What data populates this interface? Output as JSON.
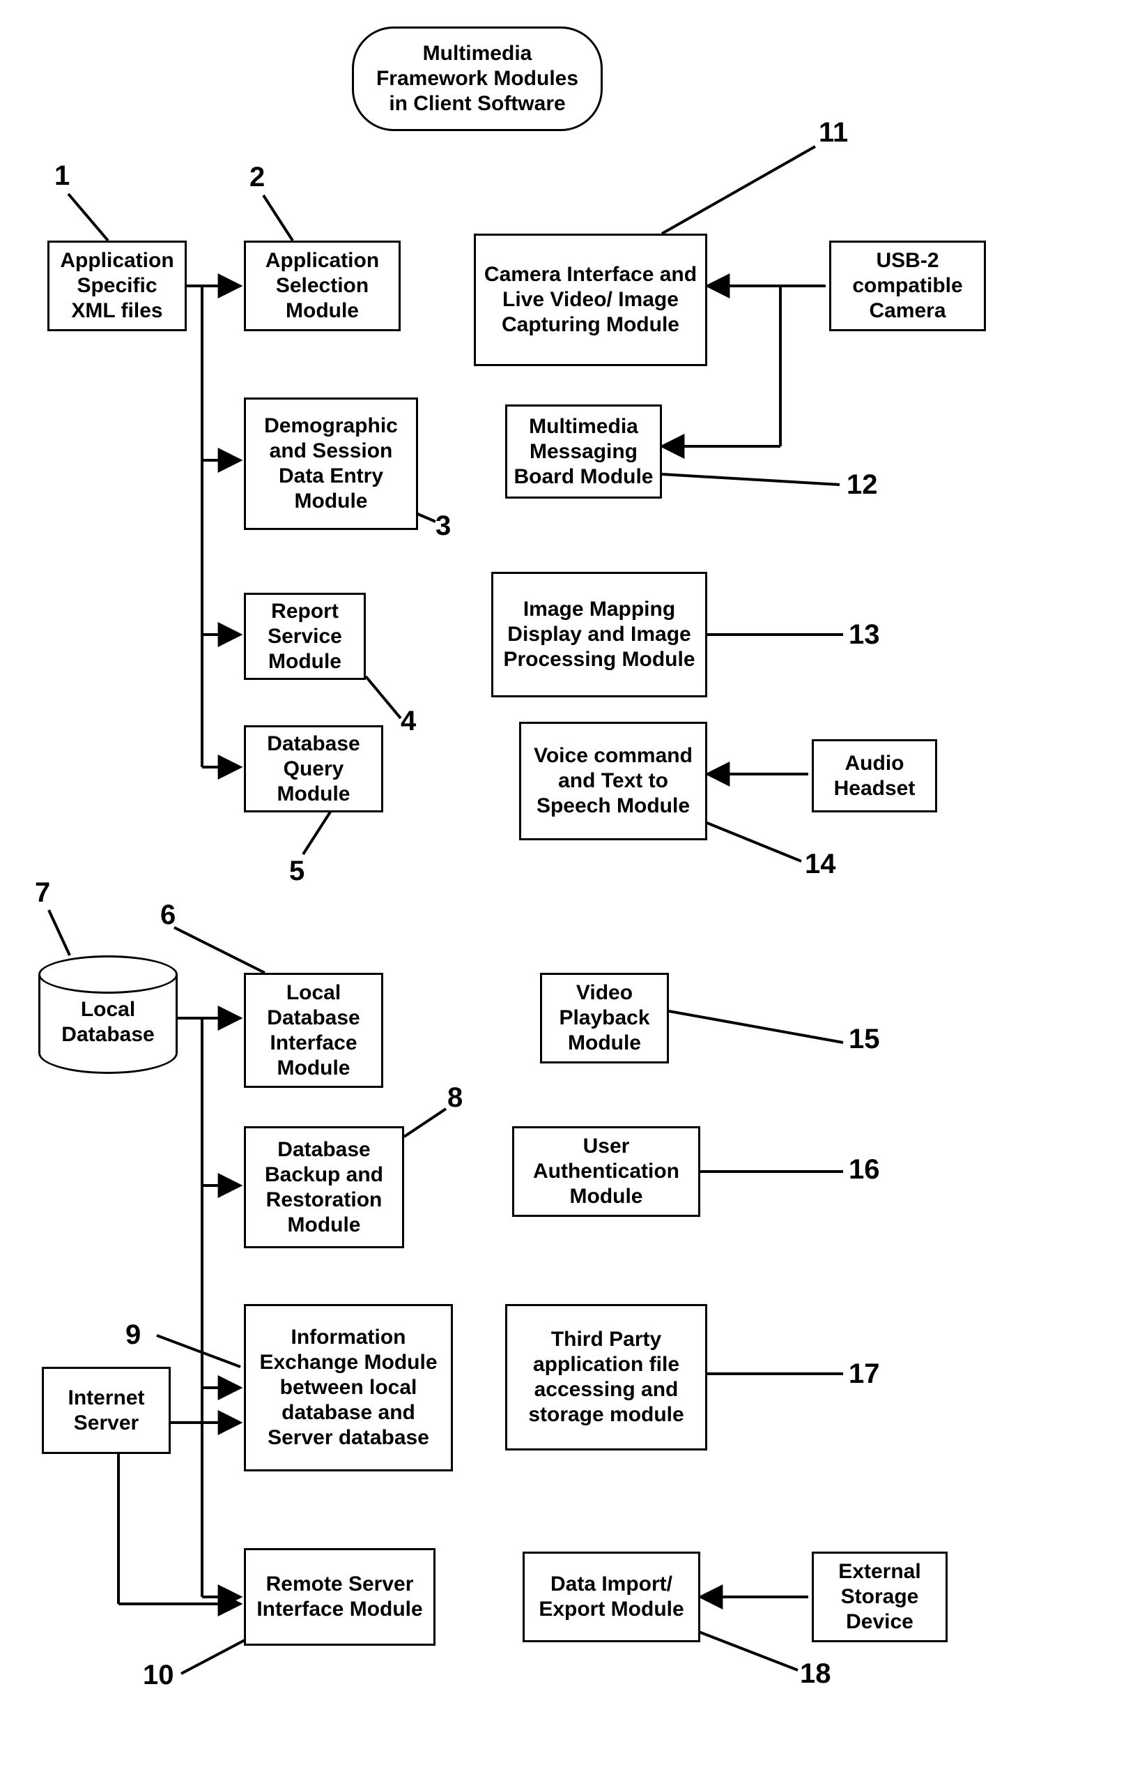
{
  "title": "Multimedia Framework Modules in Client Software",
  "nodes": {
    "n1": {
      "label": "Application Specific XML files",
      "ref": "1"
    },
    "n2": {
      "label": "Application Selection Module",
      "ref": "2"
    },
    "n3": {
      "label": "Demographic and Session Data Entry Module",
      "ref": "3"
    },
    "n4": {
      "label": "Report Service Module",
      "ref": "4"
    },
    "n5": {
      "label": "Database Query Module",
      "ref": "5"
    },
    "n6": {
      "label": "Local Database Interface Module",
      "ref": "6"
    },
    "n7": {
      "label": "Local Database",
      "ref": "7"
    },
    "n8": {
      "label": "Database Backup and Restoration Module",
      "ref": "8"
    },
    "n9": {
      "label": "Information Exchange Module between local database and Server database",
      "ref": "9"
    },
    "n10": {
      "label": "Remote Server Interface Module",
      "ref": "10"
    },
    "n11": {
      "label": "Camera Interface and Live Video/ Image Capturing Module",
      "ref": "11"
    },
    "n12": {
      "label": "Multimedia Messaging Board Module",
      "ref": "12"
    },
    "n13": {
      "label": "Image Mapping Display and Image Processing Module",
      "ref": "13"
    },
    "n14": {
      "label": "Voice command and Text to Speech Module",
      "ref": "14"
    },
    "n15": {
      "label": "Video Playback Module",
      "ref": "15"
    },
    "n16": {
      "label": "User Authentication Module",
      "ref": "16"
    },
    "n17": {
      "label": "Third Party application file accessing and storage module",
      "ref": "17"
    },
    "n18": {
      "label": "Data Import/ Export Module",
      "ref": "18"
    },
    "internet": {
      "label": "Internet Server"
    },
    "usb": {
      "label": "USB-2 compatible Camera"
    },
    "headset": {
      "label": "Audio Headset"
    },
    "extstor": {
      "label": "External Storage Device"
    }
  }
}
